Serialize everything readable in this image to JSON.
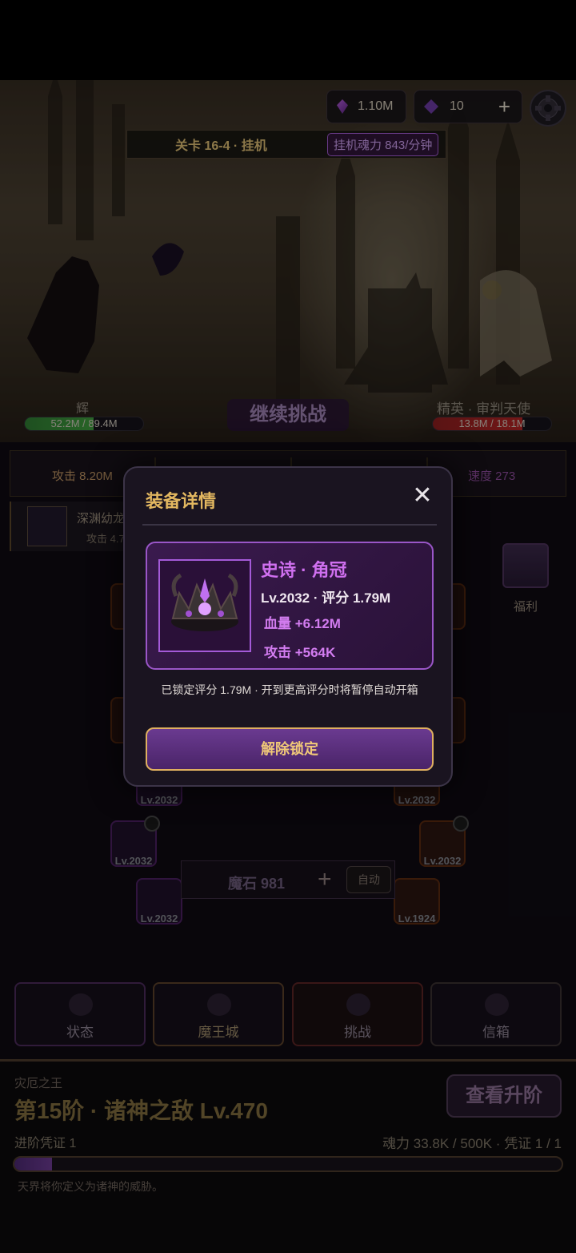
{
  "header": {
    "soul_currency": "1.10M",
    "gem_currency": "10",
    "add_label": "+",
    "stage_label": "关卡 16-4 · 挂机",
    "idle_rate": "挂机魂力 843/分钟"
  },
  "battle": {
    "hero_name": "辉",
    "hero_hp": "52.2M / 89.4M",
    "hero_hp_fraction": 0.58,
    "enemy_name": "精英 · 审判天使",
    "enemy_hp": "13.8M / 18.1M",
    "enemy_hp_fraction": 0.76,
    "continue_label": "继续挑战"
  },
  "stats": {
    "attack": "攻击 8.20M",
    "speed": "速度 273"
  },
  "item_preview": {
    "name": "深渊幼龙",
    "stat": "攻击 4.7"
  },
  "slots": {
    "lv_2032": "Lv.2032",
    "lv_1924": "Lv.1924",
    "lv_partial": "Lv"
  },
  "welfare_label": "福利",
  "mana": {
    "label": "魔石 981",
    "add_label": "+",
    "auto_label": "自动"
  },
  "tabs": [
    {
      "label": "状态"
    },
    {
      "label": "魔王城"
    },
    {
      "label": "挑战"
    },
    {
      "label": "信箱"
    }
  ],
  "rank": {
    "caption": "灾厄之王",
    "title": "第15阶 · 诸神之敌 Lv.470",
    "upgrade_label": "查看升阶",
    "voucher": "进阶凭证 1",
    "soul_progress": "魂力 33.8K / 500K · 凭证 1 / 1",
    "progress_fraction": 0.068,
    "flavor": "天界将你定义为诸神的威胁。"
  },
  "modal": {
    "title": "装备详情",
    "close": "✕",
    "equip_name": "史诗 · 角冠",
    "equip_level": "Lv.2032 · 评分 1.79M",
    "equip_hp": "血量 +6.12M",
    "equip_atk": "攻击 +564K",
    "lock_note": "已锁定评分 1.79M · 开到更高评分时将暂停自动开箱",
    "unlock_label": "解除锁定"
  },
  "colors": {
    "accent_gold": "#e2b760",
    "epic_purple": "#d070f0"
  }
}
